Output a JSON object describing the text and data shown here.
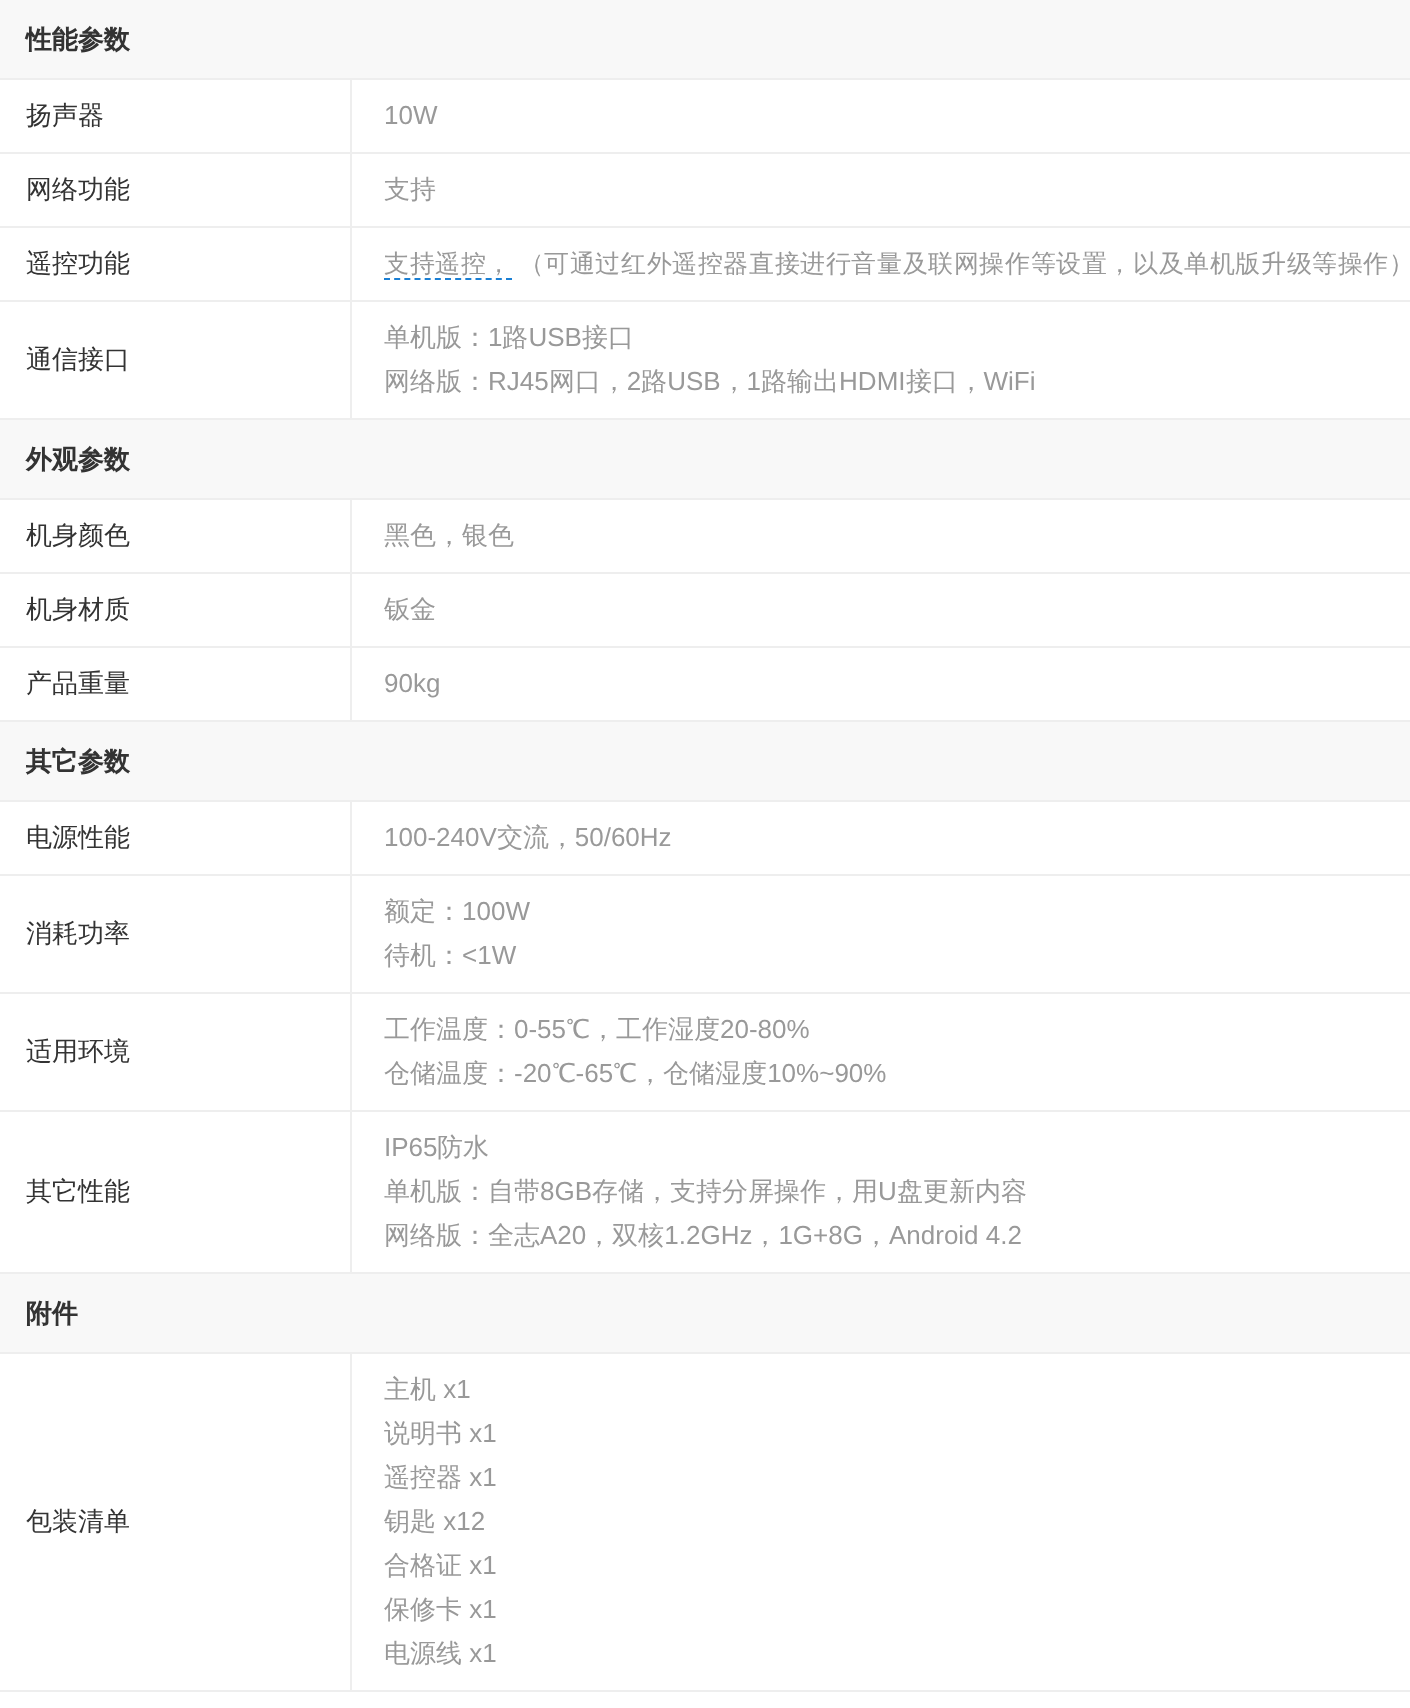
{
  "sections": [
    {
      "title": "性能参数",
      "rows": [
        {
          "label": "扬声器",
          "kind": "lines",
          "lines": [
            "10W"
          ]
        },
        {
          "label": "网络功能",
          "kind": "lines",
          "lines": [
            "支持"
          ]
        },
        {
          "label": "遥控功能",
          "kind": "link",
          "link": "支持遥控，",
          "note": "（可通过红外遥控器直接进行音量及联网操作等设置，以及单机版升级等操作）"
        },
        {
          "label": "通信接口",
          "kind": "lines",
          "lines": [
            "单机版：1路USB接口",
            "网络版：RJ45网口，2路USB，1路输出HDMI接口，WiFi"
          ]
        }
      ]
    },
    {
      "title": "外观参数",
      "rows": [
        {
          "label": "机身颜色",
          "kind": "lines",
          "lines": [
            "黑色，银色"
          ]
        },
        {
          "label": "机身材质",
          "kind": "lines",
          "lines": [
            "钣金"
          ]
        },
        {
          "label": "产品重量",
          "kind": "lines",
          "lines": [
            "90kg"
          ]
        }
      ]
    },
    {
      "title": "其它参数",
      "rows": [
        {
          "label": "电源性能",
          "kind": "lines",
          "lines": [
            "100-240V交流，50/60Hz"
          ]
        },
        {
          "label": "消耗功率",
          "kind": "lines",
          "lines": [
            "额定：100W",
            "待机：<1W"
          ]
        },
        {
          "label": "适用环境",
          "kind": "lines",
          "lines": [
            "工作温度：0-55℃，工作湿度20-80%",
            "仓储温度：-20℃-65℃，仓储湿度10%~90%"
          ]
        },
        {
          "label": "其它性能",
          "kind": "lines",
          "lines": [
            "IP65防水",
            "单机版：自带8GB存储，支持分屏操作，用U盘更新内容",
            "网络版：全志A20，双核1.2GHz，1G+8G，Android 4.2"
          ]
        }
      ]
    },
    {
      "title": "附件",
      "rows": [
        {
          "label": "包装清单",
          "kind": "lines",
          "lines": [
            "主机 x1",
            "说明书 x1",
            "遥控器 x1",
            "钥匙 x12",
            "合格证 x1",
            "保修卡 x1",
            "电源线 x1"
          ]
        }
      ]
    }
  ]
}
